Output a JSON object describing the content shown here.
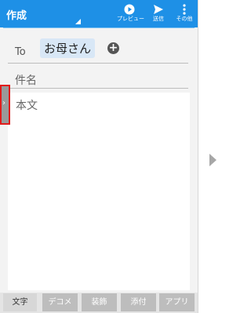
{
  "appbar": {
    "title": "作成",
    "actions": [
      {
        "label": "プレビュー",
        "icon": "play-icon"
      },
      {
        "label": "送信",
        "icon": "send-icon"
      },
      {
        "label": "その他",
        "icon": "more-vertical-icon"
      }
    ],
    "color": "#1e90e6"
  },
  "compose": {
    "to_label": "To",
    "recipient": "お母さん",
    "add_icon": "plus-circle-icon",
    "subject_placeholder": "件名",
    "body_placeholder": "本文"
  },
  "handle": {
    "icon": "chevron-right-icon",
    "highlight_color": "#e21b1b"
  },
  "bottom_tabs": [
    {
      "label": "文字",
      "active": true
    },
    {
      "label": "デコメ",
      "active": false
    },
    {
      "label": "装飾",
      "active": false
    },
    {
      "label": "添付",
      "active": false
    },
    {
      "label": "アプリ",
      "active": false
    }
  ],
  "next_arrow_icon": "triangle-right-icon"
}
